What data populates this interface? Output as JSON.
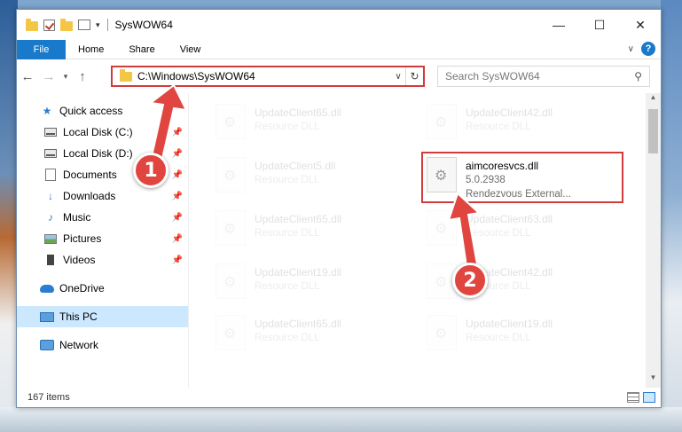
{
  "window": {
    "title": "SysWOW64",
    "controls": {
      "minimize": "—",
      "maximize": "☐",
      "close": "✕"
    }
  },
  "ribbon": {
    "tabs": [
      "File",
      "Home",
      "Share",
      "View"
    ]
  },
  "address": {
    "path": "C:\\Windows\\SysWOW64",
    "search_placeholder": "Search SysWOW64"
  },
  "nav": {
    "quick_access": "Quick access",
    "items": [
      {
        "label": "Local Disk (C:)",
        "icon": "drive-icon"
      },
      {
        "label": "Local Disk (D:)",
        "icon": "drive-icon"
      },
      {
        "label": "Documents",
        "icon": "documents-icon"
      },
      {
        "label": "Downloads",
        "icon": "downloads-icon"
      },
      {
        "label": "Music",
        "icon": "music-icon"
      },
      {
        "label": "Pictures",
        "icon": "pictures-icon"
      },
      {
        "label": "Videos",
        "icon": "videos-icon"
      }
    ],
    "onedrive": "OneDrive",
    "this_pc": "This PC",
    "network": "Network"
  },
  "files": {
    "left_column": [
      {
        "name": "UpdateClient65.dll",
        "type": "Resource DLL"
      },
      {
        "name": "UpdateClient5.dll",
        "type": "Resource DLL"
      },
      {
        "name": "UpdateClient65.dll",
        "type": "Resource DLL"
      },
      {
        "name": "UpdateClient19.dll",
        "type": "Resource DLL"
      },
      {
        "name": "UpdateClient65.dll",
        "type": "Resource DLL"
      }
    ],
    "right_column": [
      {
        "name": "UpdateClient42.dll",
        "type": "Resource DLL"
      },
      {
        "name": "aimcoresvcs.dll",
        "type": "5.0.2938",
        "desc": "Rendezvous External..."
      },
      {
        "name": "UpdateClient63.dll",
        "type": "Resource DLL"
      },
      {
        "name": "UpdateClient42.dll",
        "type": "Resource DLL"
      },
      {
        "name": "UpdateClient19.dll",
        "type": "Resource DLL"
      }
    ]
  },
  "status": {
    "item_count": "167 items"
  },
  "callouts": {
    "step1": "1",
    "step2": "2"
  },
  "colors": {
    "accent": "#1979ca",
    "highlight": "#d23b3b",
    "selection": "#cce8ff"
  }
}
